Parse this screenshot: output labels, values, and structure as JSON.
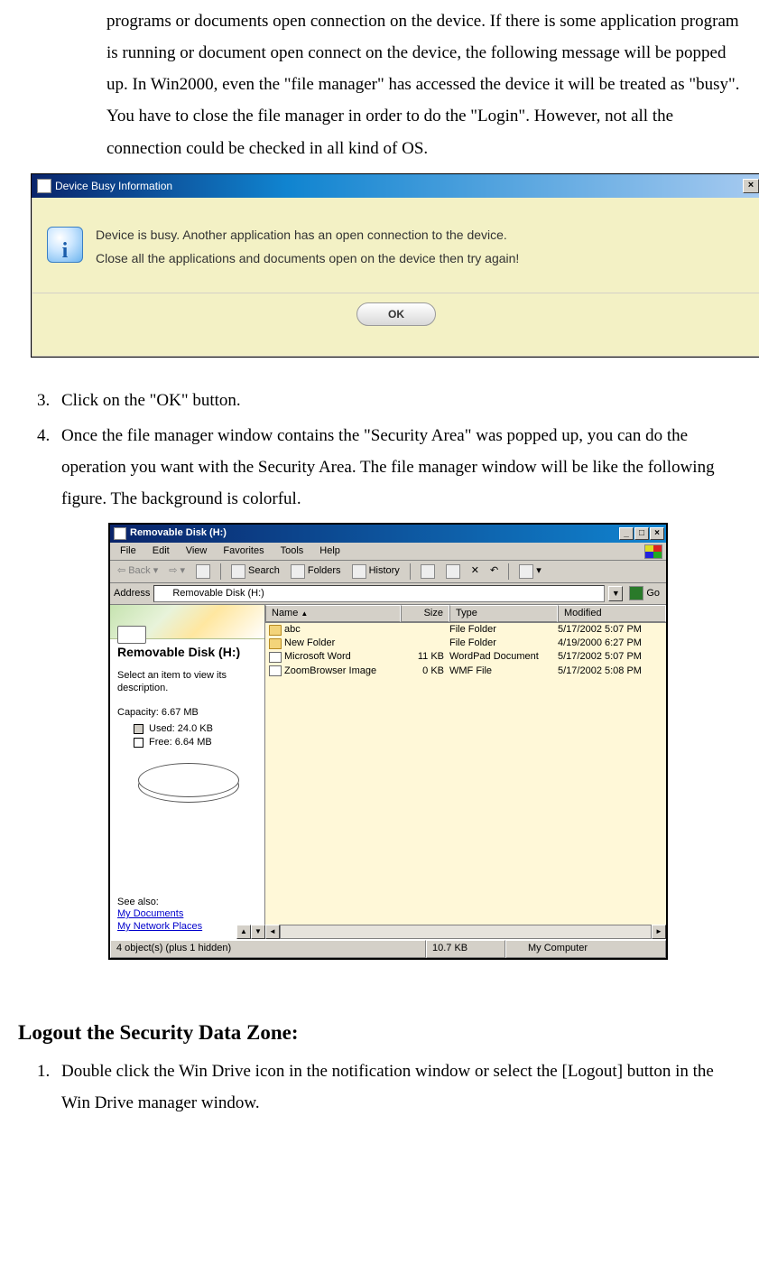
{
  "intro_paragraph": "programs or documents open connection on the device. If there is some application program is running or document open connect on the device, the following message will be popped up. In Win2000, even the \"file manager\" has accessed the device it will be treated as \"busy\". You have to close the file manager in order to do the \"Login\". However, not all the connection could be checked in all kind of OS.",
  "dialog1": {
    "title": "Device Busy Information",
    "close_glyph": "×",
    "msg_line1": "Device is busy. Another application has an open connection to the device.",
    "msg_line2": "Close all the applications and documents open on the device then try again!",
    "ok_label": "OK"
  },
  "steps_after_dialog": {
    "s3": "Click on the \"OK\" button.",
    "s4": "Once the file manager window contains the \"Security Area\" was popped up, you can do the operation you want with the Security Area. The file manager window will be like the following figure. The background is colorful."
  },
  "explorer": {
    "title": "Removable Disk (H:)",
    "min_glyph": "_",
    "max_glyph": "□",
    "close_glyph": "×",
    "menu": {
      "file": "File",
      "edit": "Edit",
      "view": "View",
      "favorites": "Favorites",
      "tools": "Tools",
      "help": "Help"
    },
    "toolbar": {
      "back": "Back",
      "search": "Search",
      "folders": "Folders",
      "history": "History"
    },
    "address_label": "Address",
    "address_value": "Removable Disk (H:)",
    "go_label": "Go",
    "left": {
      "title": "Removable Disk (H:)",
      "desc": "Select an item to view its description.",
      "capacity": "Capacity: 6.67 MB",
      "used": "Used: 24.0 KB",
      "free": "Free: 6.64 MB",
      "see_also": "See also:",
      "link1": "My Documents",
      "link2": "My Network Places"
    },
    "columns": {
      "name": "Name",
      "size": "Size",
      "type": "Type",
      "modified": "Modified"
    },
    "rows": [
      {
        "name": "abc",
        "size": "",
        "type": "File Folder",
        "modified": "5/17/2002 5:07 PM",
        "icon": "folder"
      },
      {
        "name": "New Folder",
        "size": "",
        "type": "File Folder",
        "modified": "4/19/2000 6:27 PM",
        "icon": "folder"
      },
      {
        "name": "Microsoft Word",
        "size": "11 KB",
        "type": "WordPad Document",
        "modified": "5/17/2002 5:07 PM",
        "icon": "file"
      },
      {
        "name": "ZoomBrowser Image",
        "size": "0 KB",
        "type": "WMF File",
        "modified": "5/17/2002 5:08 PM",
        "icon": "file"
      }
    ],
    "status": {
      "left": "4 object(s) (plus 1 hidden)",
      "mid": "10.7 KB",
      "right": "My Computer"
    }
  },
  "logout_heading": "Logout the Security Data Zone:",
  "logout_step1": "Double click the Win Drive icon in the notification window or select the [Logout] button in the Win Drive manager window.",
  "chart_data": {
    "type": "pie",
    "title": "Capacity: 6.67 MB",
    "series": [
      {
        "name": "Used",
        "value_label": "24.0 KB",
        "value_bytes": 24576
      },
      {
        "name": "Free",
        "value_label": "6.64 MB",
        "value_bytes": 6962544
      }
    ]
  }
}
